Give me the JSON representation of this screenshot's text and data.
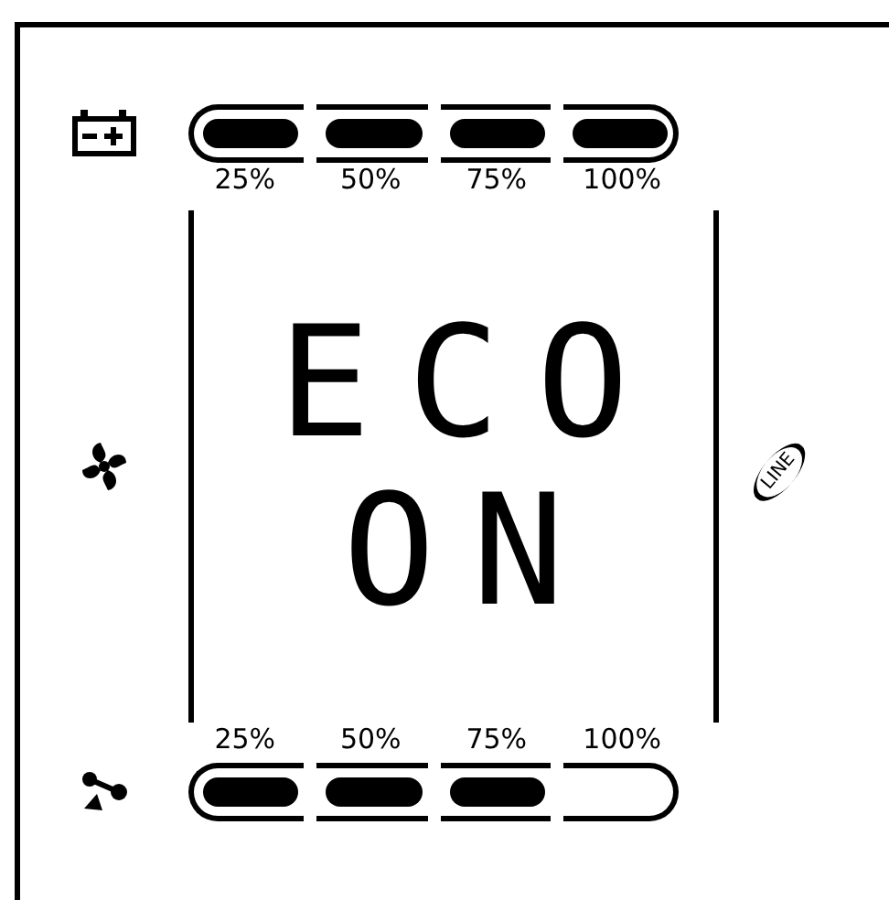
{
  "battery": {
    "segments": [
      {
        "label": "25%",
        "on": true
      },
      {
        "label": "50%",
        "on": true
      },
      {
        "label": "75%",
        "on": true
      },
      {
        "label": "100%",
        "on": true
      }
    ]
  },
  "display": {
    "line_1": "ECO",
    "line_2": "ON"
  },
  "line_indicator": {
    "label": "LINE"
  },
  "load": {
    "segments": [
      {
        "label": "25%",
        "on": true
      },
      {
        "label": "50%",
        "on": true
      },
      {
        "label": "75%",
        "on": true
      },
      {
        "label": "100%",
        "on": false
      }
    ]
  }
}
